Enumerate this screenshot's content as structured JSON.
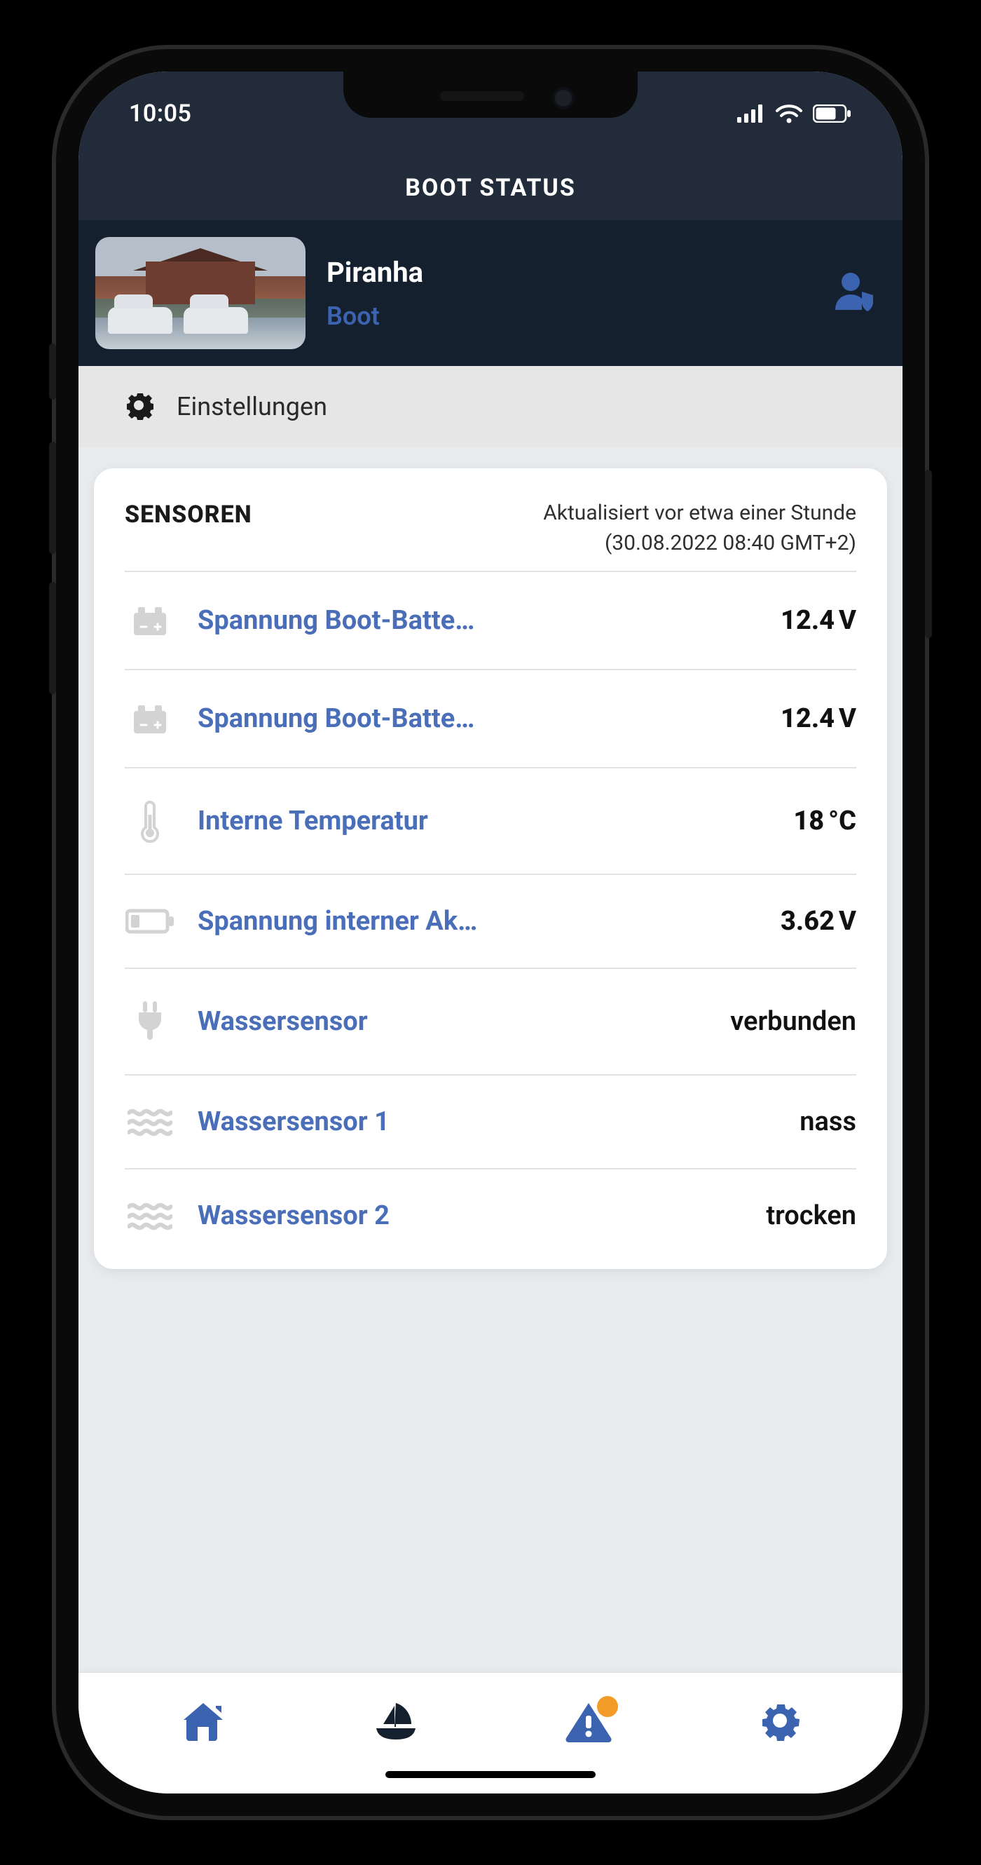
{
  "status_bar": {
    "time": "10:05"
  },
  "header": {
    "title": "BOOT STATUS"
  },
  "boat": {
    "name": "Piranha",
    "type": "Boot"
  },
  "settings_row": {
    "label": "Einstellungen"
  },
  "sensors_section": {
    "title": "SENSOREN",
    "updated_label": "Aktualisiert vor etwa einer Stunde",
    "timestamp": "(30.08.2022 08:40 GMT+2)"
  },
  "sensors": [
    {
      "icon": "battery",
      "name": "Spannung Boot-Batte…",
      "value": "12.4",
      "unit": "V"
    },
    {
      "icon": "battery",
      "name": "Spannung Boot-Batte…",
      "value": "12.4",
      "unit": "V"
    },
    {
      "icon": "thermometer",
      "name": "Interne Temperatur",
      "value": "18",
      "unit": "°C"
    },
    {
      "icon": "battery-h",
      "name": "Spannung interner Ak…",
      "value": "3.62",
      "unit": "V"
    },
    {
      "icon": "plug",
      "name": "Wassersensor",
      "value": "verbunden",
      "text": true
    },
    {
      "icon": "waves",
      "name": "Wassersensor 1",
      "value": "nass",
      "text": true
    },
    {
      "icon": "waves",
      "name": "Wassersensor 2",
      "value": "trocken",
      "text": true
    }
  ],
  "tabs": [
    {
      "id": "home",
      "color": "#3b63b0",
      "badge": false
    },
    {
      "id": "boat",
      "color": "#14202e",
      "badge": false
    },
    {
      "id": "alerts",
      "color": "#3b63b0",
      "badge": true
    },
    {
      "id": "gear",
      "color": "#3b63b0",
      "badge": false
    }
  ]
}
